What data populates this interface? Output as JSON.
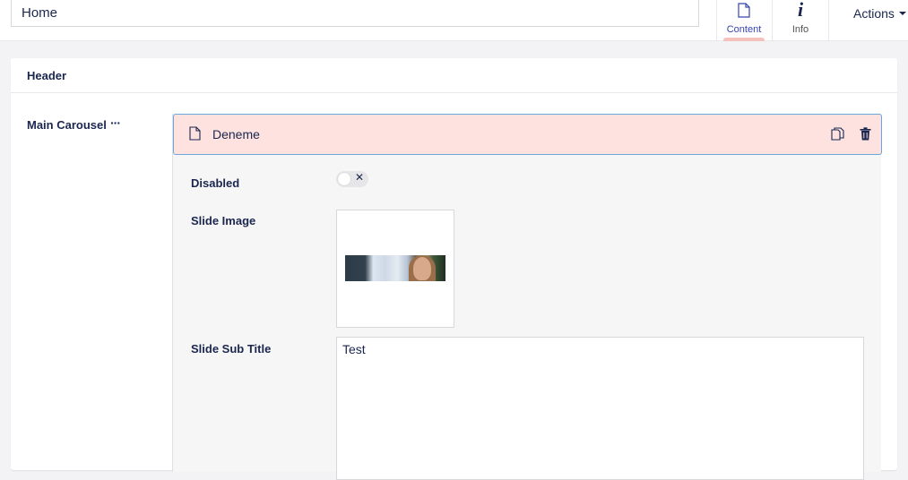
{
  "header": {
    "name_value": "Home",
    "apps": [
      {
        "label": "Content",
        "icon": "document-icon",
        "active": true
      },
      {
        "label": "Info",
        "icon": "info-icon",
        "active": false
      }
    ],
    "actions_label": "Actions"
  },
  "panel": {
    "title": "Header",
    "property_label": "Main Carousel",
    "block": {
      "title": "Deneme",
      "fields": {
        "disabled_label": "Disabled",
        "disabled_value": false,
        "slide_image_label": "Slide Image",
        "slide_subtitle_label": "Slide Sub Title",
        "slide_subtitle_value": "Test"
      }
    }
  },
  "colors": {
    "accent": "#3544b1",
    "block_head_bg": "#fde2df",
    "block_head_border": "#6ba6dc",
    "tab_indicator": "#f5c1bc"
  }
}
